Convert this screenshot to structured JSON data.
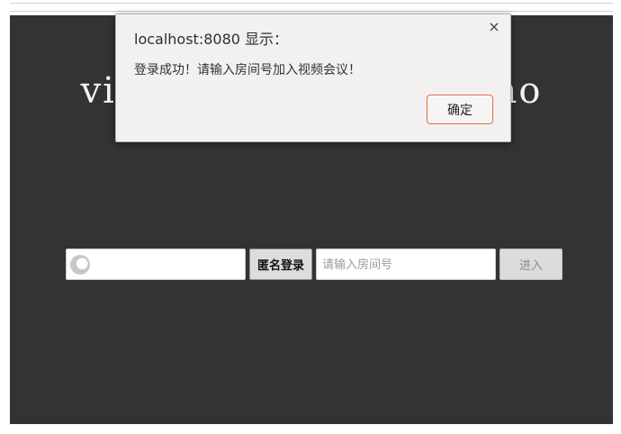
{
  "background_app": {
    "title": "video conference demo",
    "name_input": {
      "value": "",
      "placeholder": ""
    },
    "anonymous_login_label": "匿名登录",
    "room_input": {
      "value": "",
      "placeholder": "请输入房间号"
    },
    "enter_label": "进入"
  },
  "alert_dialog": {
    "title": "localhost:8080 显示：",
    "message": "登录成功！请输入房间号加入视频会议！",
    "ok_label": "确定",
    "close_icon": "close-icon"
  },
  "colors": {
    "app_background": "#333333",
    "dialog_background": "#f2f1f0",
    "ok_button_border": "#e06d3a"
  }
}
